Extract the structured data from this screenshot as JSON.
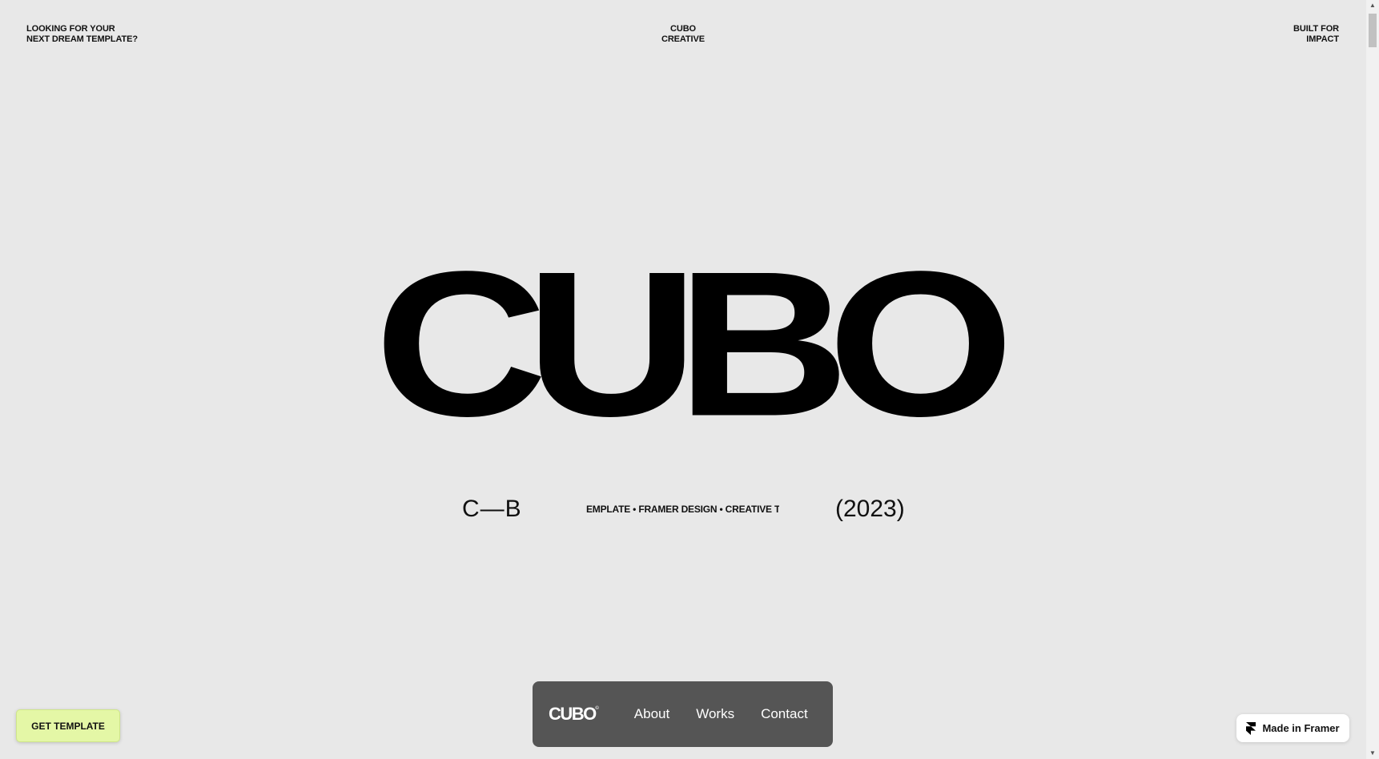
{
  "header": {
    "left_line1": "LOOKING FOR YOUR",
    "left_line2": "NEXT DREAM TEMPLATE?",
    "center_line1": "CUBO",
    "center_line2": "CREATIVE",
    "right_line1": "BUILT FOR",
    "right_line2": "IMPACT"
  },
  "hero": {
    "word": "CUBO",
    "left_caption": "C—B",
    "marquee_text": "EMPLATE •   FRAMER DESIGN • CREATIVE TE",
    "year": "(2023)"
  },
  "nav": {
    "logo": "CUBO",
    "logo_mark": "©",
    "links": [
      "About",
      "Works",
      "Contact"
    ]
  },
  "cta": {
    "get_template_label": "GET TEMPLATE",
    "get_template_color": "#e4f7a6"
  },
  "badge": {
    "label": "Made in Framer",
    "icon": "framer-icon"
  },
  "colors": {
    "background": "#e8e8e8",
    "nav_background": "#555555",
    "text": "#111111"
  }
}
